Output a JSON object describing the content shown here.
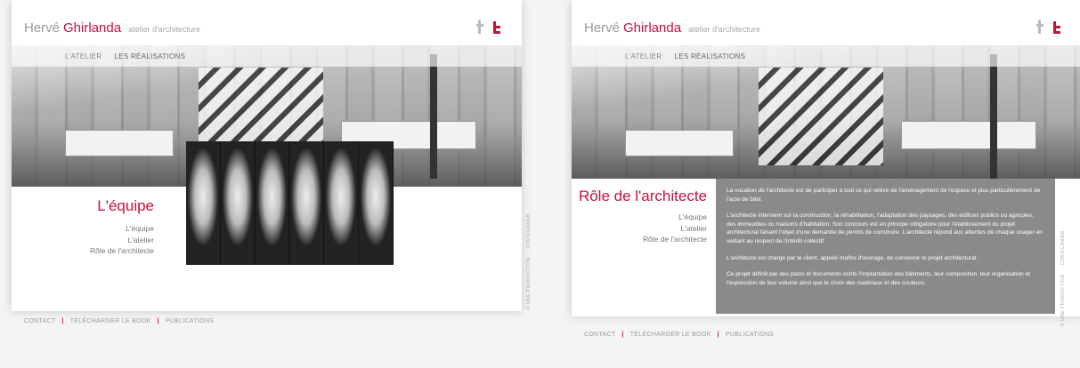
{
  "brand": {
    "first": "Hervé",
    "last": "Ghirlanda",
    "tagline": "atelier d'architecture"
  },
  "social": [
    "facebook-icon",
    "twitter-icon"
  ],
  "nav": {
    "items": [
      "L'ATELIER",
      "LES RÉALISATIONS"
    ]
  },
  "page1": {
    "title": "L'équipe",
    "submenu": [
      "L'équipe",
      "L'atelier",
      "Rôle de l'architecte"
    ],
    "faces": 6
  },
  "page2": {
    "title": "Rôle de l'architecte",
    "submenu": [
      "L'équipe",
      "L'atelier",
      "Rôle de l'architecte"
    ],
    "paragraphs": [
      "La vocation de l'architecte est de participer à tout ce qui relève de l'aménagement de l'espace et plus particulièrement de l'acte de bâtir.",
      "L'architecte intervient sur la construction, la réhabilitation, l'adaptation des paysages, des édifices publics ou agricoles, des immeubles ou maisons d'habitation. Son concours est en principe obligatoire pour l'établissement du projet architectural faisant l'objet d'une demande de permis de construire. L'architecte répond aux attentes de chaque usager en veillant au respect de l'intérêt collectif.",
      "L'architecte est chargé par le client, appelé maître d'ouvrage, de concevoir le projet architectural.",
      "Ce projet définit par des plans et documents écrits l'implantation des bâtiments, leur composition, leur organisation et l'expression de leur volume ainsi que le choix des matériaux et des couleurs."
    ]
  },
  "footer": {
    "links": [
      "CONTACT",
      "TÉLÉCHARGER LE BOOK",
      "PUBLICATIONS"
    ]
  },
  "credit": {
    "left": "© UNE PRODUCTION",
    "right": "CORSICAWEB"
  }
}
